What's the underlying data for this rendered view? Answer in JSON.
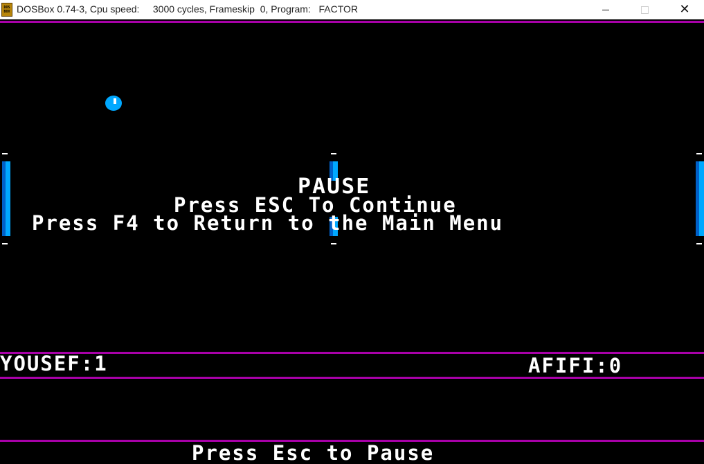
{
  "window": {
    "title": "DOSBox 0.74-3, Cpu speed:     3000 cycles, Frameskip  0, Program:   FACTOR",
    "icon_label_top": "DOS",
    "icon_label_bottom": "BOX",
    "close_glyph": "✕"
  },
  "game": {
    "pause_title": "PAUSE",
    "continue_hint": "Press ESC To Continue",
    "menu_hint": "Press F4 to Return to the Main Menu",
    "player_left": {
      "name_score": "YOUSEF:1"
    },
    "player_right": {
      "name_score": "AFIFI:0"
    },
    "bottom_hint": "Press Esc to Pause",
    "colors": {
      "background": "#000000",
      "divider": "#a800a8",
      "paddle": "#00a8ff",
      "ball": "#00a8ff",
      "text": "#ffffff"
    }
  }
}
